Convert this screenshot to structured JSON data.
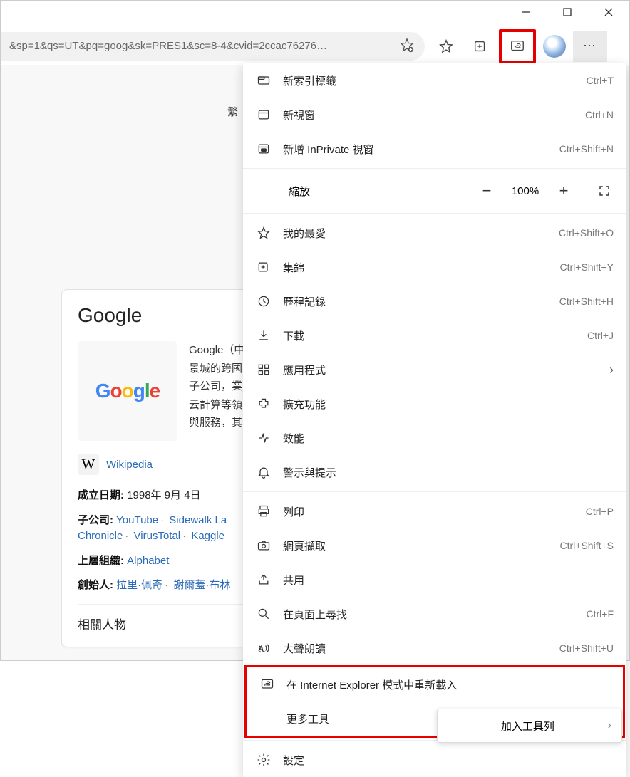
{
  "url": "&sp=1&qs=UT&pq=goog&sk=PRES1&sc=8-4&cvid=2ccac76276…",
  "page": {
    "lang_label": "繁",
    "card": {
      "title": "Google",
      "desc_lines": [
        "Google（中",
        "景城的跨國",
        "子公司，業",
        "云計算等領",
        "與服務，其"
      ],
      "wiki": "Wikipedia",
      "founded_label": "成立日期:",
      "founded_value": "1998年 9月 4日",
      "subsidiary_label": "子公司:",
      "subsidiaries": [
        "YouTube",
        "Sidewalk La",
        "Chronicle",
        "VirusTotal",
        "Kaggle"
      ],
      "parent_label": "上層組織:",
      "parent_value": "Alphabet",
      "founders_label": "創始人:",
      "founders": [
        "拉里·佩奇",
        "謝爾蓋·布林"
      ],
      "related": "相關人物"
    }
  },
  "menu": {
    "new_tab": {
      "label": "新索引標籤",
      "shortcut": "Ctrl+T"
    },
    "new_window": {
      "label": "新視窗",
      "shortcut": "Ctrl+N"
    },
    "new_inprivate": {
      "label": "新增 InPrivate 視窗",
      "shortcut": "Ctrl+Shift+N"
    },
    "zoom": {
      "label": "縮放",
      "value": "100%"
    },
    "favorites": {
      "label": "我的最愛",
      "shortcut": "Ctrl+Shift+O"
    },
    "collections": {
      "label": "集錦",
      "shortcut": "Ctrl+Shift+Y"
    },
    "history": {
      "label": "歷程記錄",
      "shortcut": "Ctrl+Shift+H"
    },
    "downloads": {
      "label": "下載",
      "shortcut": "Ctrl+J"
    },
    "apps": {
      "label": "應用程式"
    },
    "extensions": {
      "label": "擴充功能"
    },
    "performance": {
      "label": "效能"
    },
    "alerts": {
      "label": "警示與提示"
    },
    "print": {
      "label": "列印",
      "shortcut": "Ctrl+P"
    },
    "capture": {
      "label": "網頁擷取",
      "shortcut": "Ctrl+Shift+S"
    },
    "share": {
      "label": "共用"
    },
    "find": {
      "label": "在頁面上尋找",
      "shortcut": "Ctrl+F"
    },
    "readaloud": {
      "label": "大聲朗讀",
      "shortcut": "Ctrl+Shift+U"
    },
    "ie_mode": {
      "label": "在 Internet Explorer 模式中重新載入"
    },
    "more_tools": {
      "label": "更多工具"
    },
    "settings": {
      "label": "設定"
    },
    "submenu_pin": "加入工具列"
  }
}
